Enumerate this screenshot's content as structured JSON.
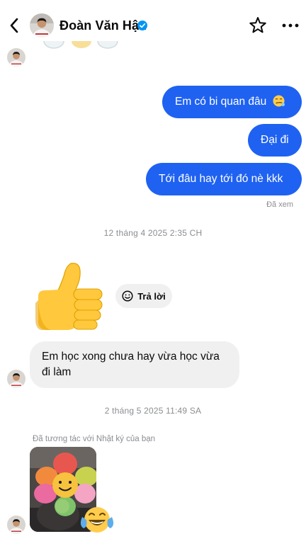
{
  "header": {
    "contact_name": "Đoàn Văn Hậu",
    "verified_icon": "verified-badge-icon",
    "back_icon": "chevron-left-icon",
    "star_icon": "star-outline-icon",
    "more_icon": "more-horizontal-icon"
  },
  "messages": {
    "out_1": "Em có bi quan đâu",
    "out_1_emoji": "smirking-face-icon",
    "out_2": "Đại đi",
    "out_3": "Tới đâu hay tới đó nè kkk",
    "seen_label": "Đã xem",
    "timestamp_1": "12 tháng 4 2025 2:35 CH",
    "thumbs_up": "thumbs-up-emoji",
    "reply_label": "Trả lời",
    "in_1": "Em học xong chưa hay vừa học vừa đi làm",
    "timestamp_2": "2 tháng 5 2025 11:49 SA",
    "reaction_note": "Đã tương tác với Nhật ký của bạn",
    "story_reaction": "laughing-tears-emoji"
  },
  "colors": {
    "outgoing_bubble": "#1f62f2",
    "incoming_bubble": "#f0f0f0",
    "muted_text": "#8a8d91",
    "verified": "#0095f6"
  }
}
